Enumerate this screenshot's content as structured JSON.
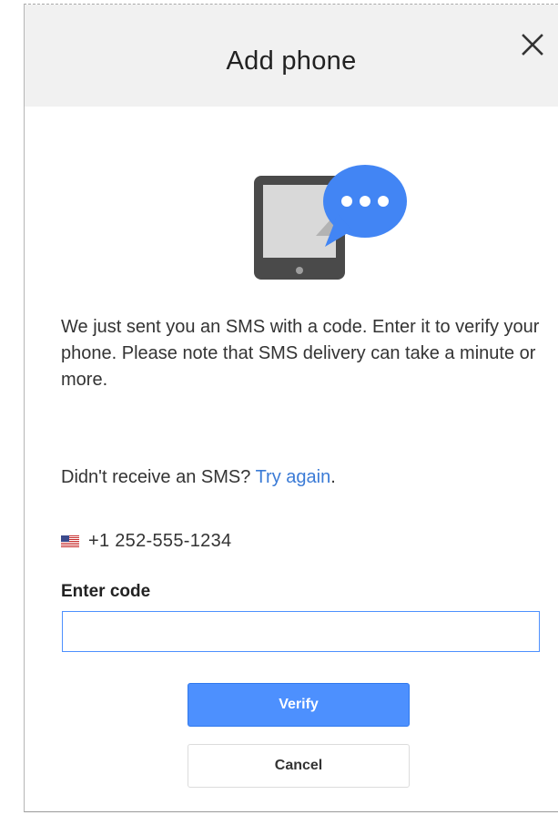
{
  "dialog": {
    "title": "Add phone",
    "close_icon": "close-icon",
    "illustration_icon": "phone-sms-icon"
  },
  "message": {
    "body": "We just sent you an SMS with a code. Enter it to verify your phone. Please note that SMS delivery can take a minute or more.",
    "resend_prefix": "Didn't receive an SMS?",
    "resend_link": "Try again",
    "resend_suffix": "."
  },
  "phone": {
    "flag_icon": "us-flag-icon",
    "number": "+1 252-555-1234"
  },
  "code": {
    "label": "Enter code",
    "value": "",
    "placeholder": ""
  },
  "actions": {
    "verify_label": "Verify",
    "cancel_label": "Cancel"
  },
  "colors": {
    "accent": "#4d90fe",
    "link": "#3b7bd6",
    "header_bg": "#f1f1f1",
    "bubble": "#4285f4",
    "device": "#4a4a4a"
  }
}
